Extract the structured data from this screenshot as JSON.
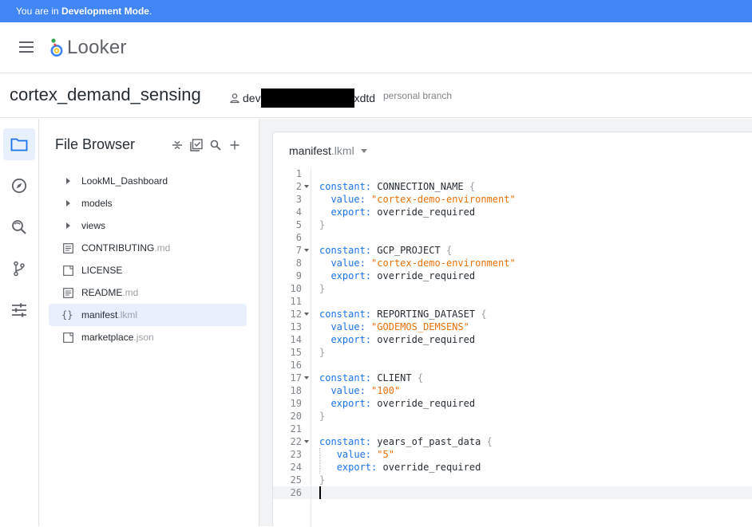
{
  "devbar": {
    "prefix": "You are in ",
    "mode": "Development Mode",
    "suffix": "."
  },
  "app": {
    "logo_text": "Looker"
  },
  "project": {
    "title": "cortex_demand_sensing",
    "branch_prefix": "dev",
    "branch_suffix": "xdtd",
    "branch_type": "personal branch"
  },
  "rail": {
    "items": [
      {
        "icon": "folder-icon",
        "active": true
      },
      {
        "icon": "compass-icon",
        "active": false
      },
      {
        "icon": "find-replace-icon",
        "active": false
      },
      {
        "icon": "git-branch-icon",
        "active": false
      },
      {
        "icon": "tune-icon",
        "active": false
      }
    ]
  },
  "filebrowser": {
    "title": "File Browser",
    "tools": [
      "collapse-all-icon",
      "bulk-select-icon",
      "search-icon",
      "add-icon"
    ],
    "items": [
      {
        "name": "LookML_Dashboard",
        "ext": "",
        "kind": "folder"
      },
      {
        "name": "models",
        "ext": "",
        "kind": "folder"
      },
      {
        "name": "views",
        "ext": "",
        "kind": "folder"
      },
      {
        "name": "CONTRIBUTING",
        "ext": ".md",
        "kind": "doc"
      },
      {
        "name": "LICENSE",
        "ext": "",
        "kind": "file"
      },
      {
        "name": "README",
        "ext": ".md",
        "kind": "doc"
      },
      {
        "name": "manifest",
        "ext": ".lkml",
        "kind": "lkml",
        "selected": true
      },
      {
        "name": "marketplace",
        "ext": ".json",
        "kind": "file"
      }
    ]
  },
  "editor": {
    "tab_name": "manifest",
    "tab_ext": ".lkml",
    "lines": [
      "",
      "constant: CONNECTION_NAME {",
      "  value: \"cortex-demo-environment\"",
      "  export: override_required",
      "}",
      "",
      "constant: GCP_PROJECT {",
      "  value: \"cortex-demo-environment\"",
      "  export: override_required",
      "}",
      "",
      "constant: REPORTING_DATASET {",
      "  value: \"GODEMOS_DEMSENS\"",
      "  export: override_required",
      "}",
      "",
      "constant: CLIENT {",
      "  value: \"100\"",
      "  export: override_required",
      "}",
      "",
      "constant: years_of_past_data {",
      "   value: \"5\"",
      "   export: override_required",
      "}",
      ""
    ],
    "fold_lines": [
      2,
      7,
      12,
      17,
      22
    ]
  }
}
